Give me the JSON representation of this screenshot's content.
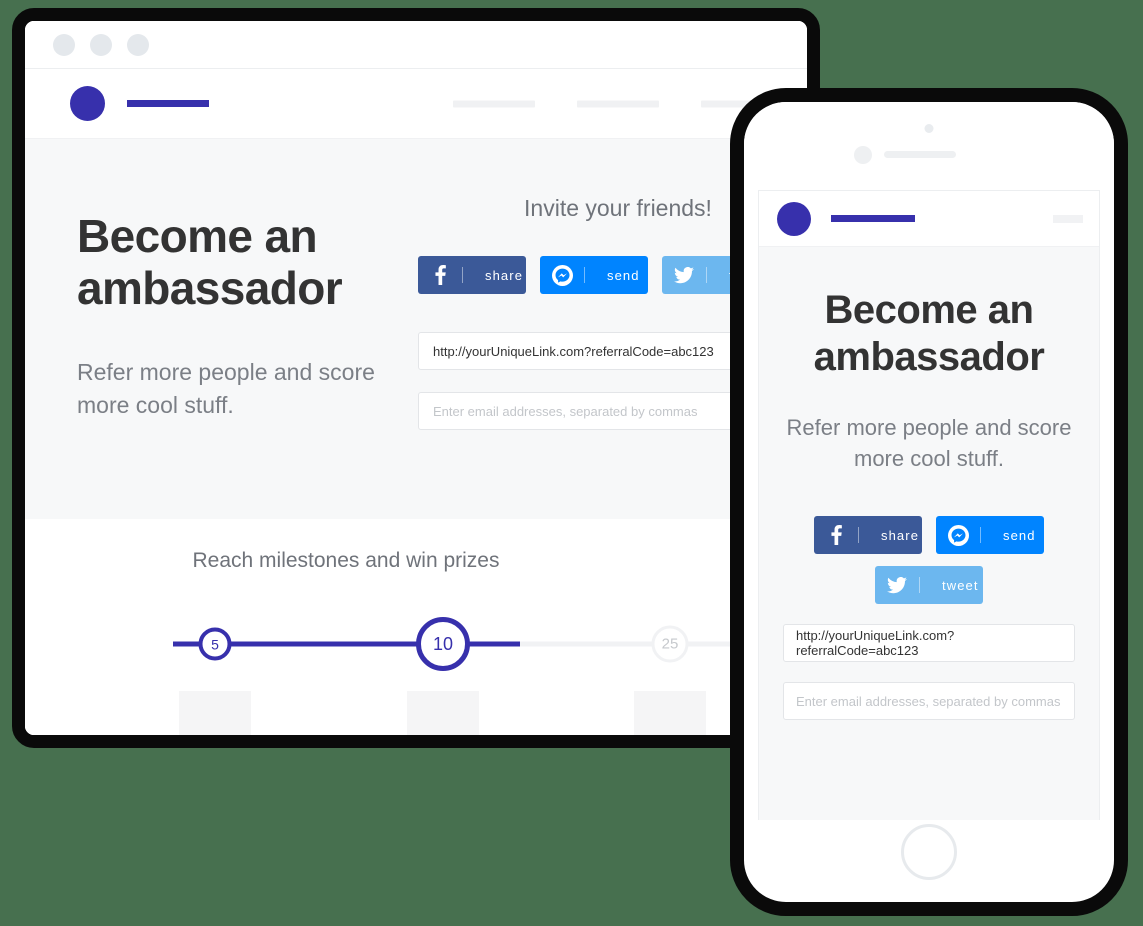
{
  "theme": {
    "brand_purple": "#3730ac",
    "facebook_blue": "#3b5998",
    "messenger_blue": "#0084ff",
    "twitter_blue": "#6cb7ef",
    "page_background": "#47704f",
    "hero_background": "#f7f8f9",
    "text_dark": "#333333",
    "text_muted": "#7b7f86"
  },
  "browser": {
    "traffic_lights": [
      "close",
      "minimize",
      "maximize"
    ],
    "nav_placeholders": 3,
    "hero": {
      "title": "Become an ambassador",
      "subtitle": "Refer more people and score more cool stuff.",
      "invite_heading": "Invite your friends!",
      "share_buttons": [
        {
          "network": "facebook",
          "icon": "facebook-icon",
          "label": "share"
        },
        {
          "network": "messenger",
          "icon": "messenger-icon",
          "label": "send"
        },
        {
          "network": "twitter",
          "icon": "twitter-icon",
          "label": "tweet"
        }
      ],
      "referral_link": "http://yourUniqueLink.com?referralCode=abc123",
      "email_placeholder": "Enter email addresses, separated by commas"
    },
    "milestones": {
      "heading": "Reach milestones and win prizes",
      "nodes": [
        {
          "value": "5",
          "state": "complete"
        },
        {
          "value": "10",
          "state": "current"
        },
        {
          "value": "25",
          "state": "locked"
        }
      ],
      "prize_placeholders": 3
    }
  },
  "phone": {
    "menu_placeholder": true,
    "hero": {
      "title": "Become an ambassador",
      "subtitle": "Refer more people and score more cool stuff.",
      "share_buttons": [
        {
          "network": "facebook",
          "icon": "facebook-icon",
          "label": "share"
        },
        {
          "network": "messenger",
          "icon": "messenger-icon",
          "label": "send"
        },
        {
          "network": "twitter",
          "icon": "twitter-icon",
          "label": "tweet"
        }
      ],
      "referral_link": "http://yourUniqueLink.com?referralCode=abc123",
      "email_placeholder": "Enter email addresses, separated by commas"
    }
  }
}
